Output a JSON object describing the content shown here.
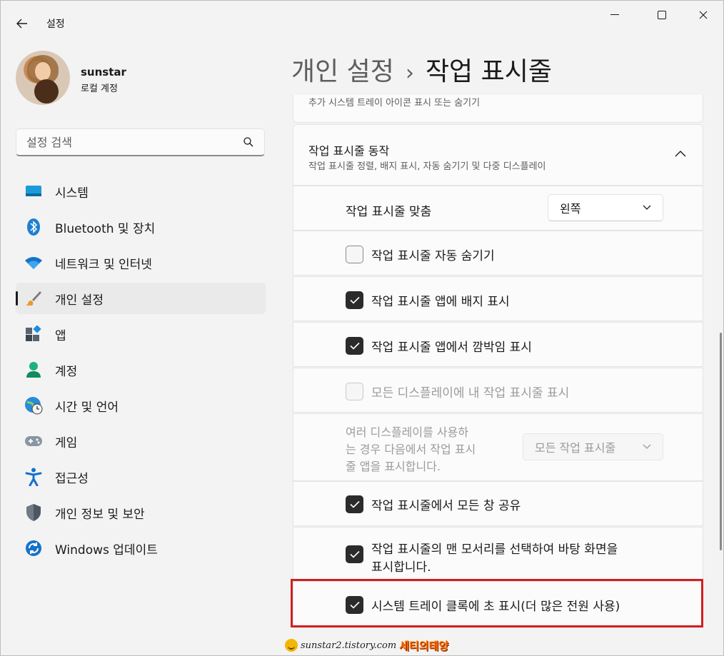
{
  "window": {
    "app_title": "설정",
    "back_icon": "back-arrow-icon",
    "min_icon": "minimize-icon",
    "max_icon": "maximize-icon",
    "close_icon": "close-icon"
  },
  "profile": {
    "name": "sunstar",
    "account_type": "로컬 계정"
  },
  "search": {
    "placeholder": "설정 검색"
  },
  "nav": {
    "items": [
      {
        "label": "시스템",
        "icon": "system-display-icon"
      },
      {
        "label": "Bluetooth 및 장치",
        "icon": "bluetooth-icon"
      },
      {
        "label": "네트워크 및 인터넷",
        "icon": "wifi-icon"
      },
      {
        "label": "개인 설정",
        "icon": "brush-icon",
        "active": true
      },
      {
        "label": "앱",
        "icon": "apps-icon"
      },
      {
        "label": "계정",
        "icon": "person-icon"
      },
      {
        "label": "시간 및 언어",
        "icon": "globe-clock-icon"
      },
      {
        "label": "게임",
        "icon": "gamepad-icon"
      },
      {
        "label": "접근성",
        "icon": "accessibility-icon"
      },
      {
        "label": "개인 정보 및 보안",
        "icon": "shield-icon"
      },
      {
        "label": "Windows 업데이트",
        "icon": "update-icon"
      }
    ]
  },
  "header": {
    "crumb": "개인 설정",
    "separator": "›",
    "title": "작업 표시줄"
  },
  "content": {
    "top_card_text": "추가 시스템 트레이 아이콘 표시 또는 숨기기",
    "group": {
      "title": "작업 표시줄 동작",
      "subtitle": "작업 표시줄 정렬, 배지 표시, 자동 숨기기 및 다중 디스플레이"
    },
    "alignment": {
      "label": "작업 표시줄 맞춤",
      "value": "왼쪽"
    },
    "options": [
      {
        "label": "작업 표시줄 자동 숨기기",
        "checked": false
      },
      {
        "label": "작업 표시줄 앱에 배지 표시",
        "checked": true
      },
      {
        "label": "작업 표시줄 앱에서 깜박임 표시",
        "checked": true
      },
      {
        "label": "모든 디스플레이에 내 작업 표시줄 표시",
        "checked": false,
        "disabled": true
      }
    ],
    "multi_display": {
      "line1": "여러 디스플레이를 사용하",
      "line2": "는 경우 다음에서 작업 표시",
      "line3": "줄 앱을 표시합니다.",
      "value": "모든 작업 표시줄"
    },
    "share_any_window": {
      "label": "작업 표시줄에서 모든 창 공유",
      "checked": true
    },
    "far_corner": {
      "line1": "작업 표시줄의 맨 모서리를 선택하여 바탕 화면을",
      "line2": "표시합니다.",
      "checked": true
    },
    "seconds_clock": {
      "label": "시스템 트레이 클록에 초 표시(더 많은 전원 사용)",
      "checked": true
    }
  },
  "watermark": {
    "url": "sunstar2.tistory.com",
    "name": "세티의태양"
  },
  "colors": {
    "highlight": "#d21f1f",
    "checkbox_on": "#2b2b2b"
  }
}
